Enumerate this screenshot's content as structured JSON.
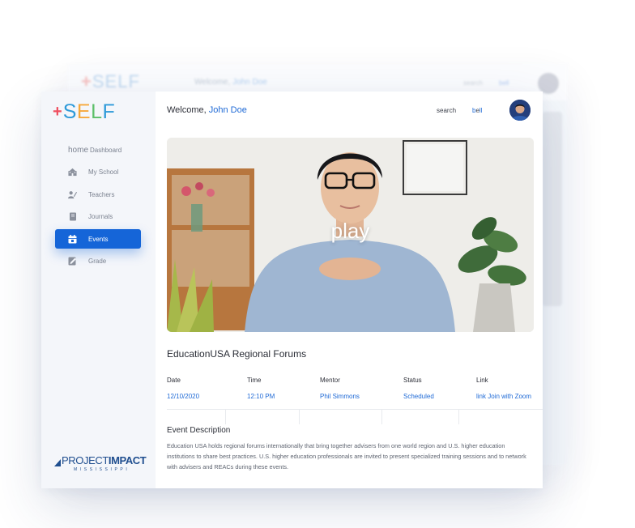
{
  "app": {
    "logo": {
      "plus": "+",
      "letters": [
        "S",
        "E",
        "L",
        "F"
      ]
    },
    "colors": {
      "accent": "#1565d8",
      "link": "#1f6ad6",
      "sidebar_bg": "#f4f6fa"
    }
  },
  "background_window": {
    "welcome_prefix": "Welcome,",
    "user_name": "John Doe",
    "search_label": "search",
    "bell_label": "bell"
  },
  "sidebar": {
    "items": [
      {
        "icon": "home-icon",
        "prefix": "home",
        "label": "Dashboard",
        "active": false
      },
      {
        "icon": "school-icon",
        "label": "My School",
        "active": false
      },
      {
        "icon": "teachers-icon",
        "label": "Teachers",
        "active": false
      },
      {
        "icon": "journal-icon",
        "label": "Journals",
        "active": false
      },
      {
        "icon": "calendar-icon",
        "label": "Events",
        "active": true
      },
      {
        "icon": "grade-icon",
        "label": "Grade",
        "active": false
      }
    ],
    "partner": {
      "word1": "PROJECT",
      "word2": "IMPACT",
      "sub": "MISSISSIPPI"
    }
  },
  "header": {
    "welcome_prefix": "Welcome,",
    "user_name": "John Doe",
    "search_label": "search",
    "bell_label": "bell"
  },
  "video": {
    "play_label": "play"
  },
  "event": {
    "title": "EducationUSA Regional Forums",
    "columns": [
      "Date",
      "Time",
      "Mentor",
      "Status",
      "Link"
    ],
    "values": {
      "date": "12/10/2020",
      "time": "12:10 PM",
      "mentor": "Phil Simmons",
      "status": "Scheduled",
      "link": "link Join with Zoom"
    },
    "description_title": "Event Description",
    "description": "Education USA holds regional forums internationally that bring together advisers from one world region and U.S. higher education institutions to share best practices. U.S. higher education professionals are invited to present specialized training sessions and to network with advisers and REACs during these events."
  }
}
